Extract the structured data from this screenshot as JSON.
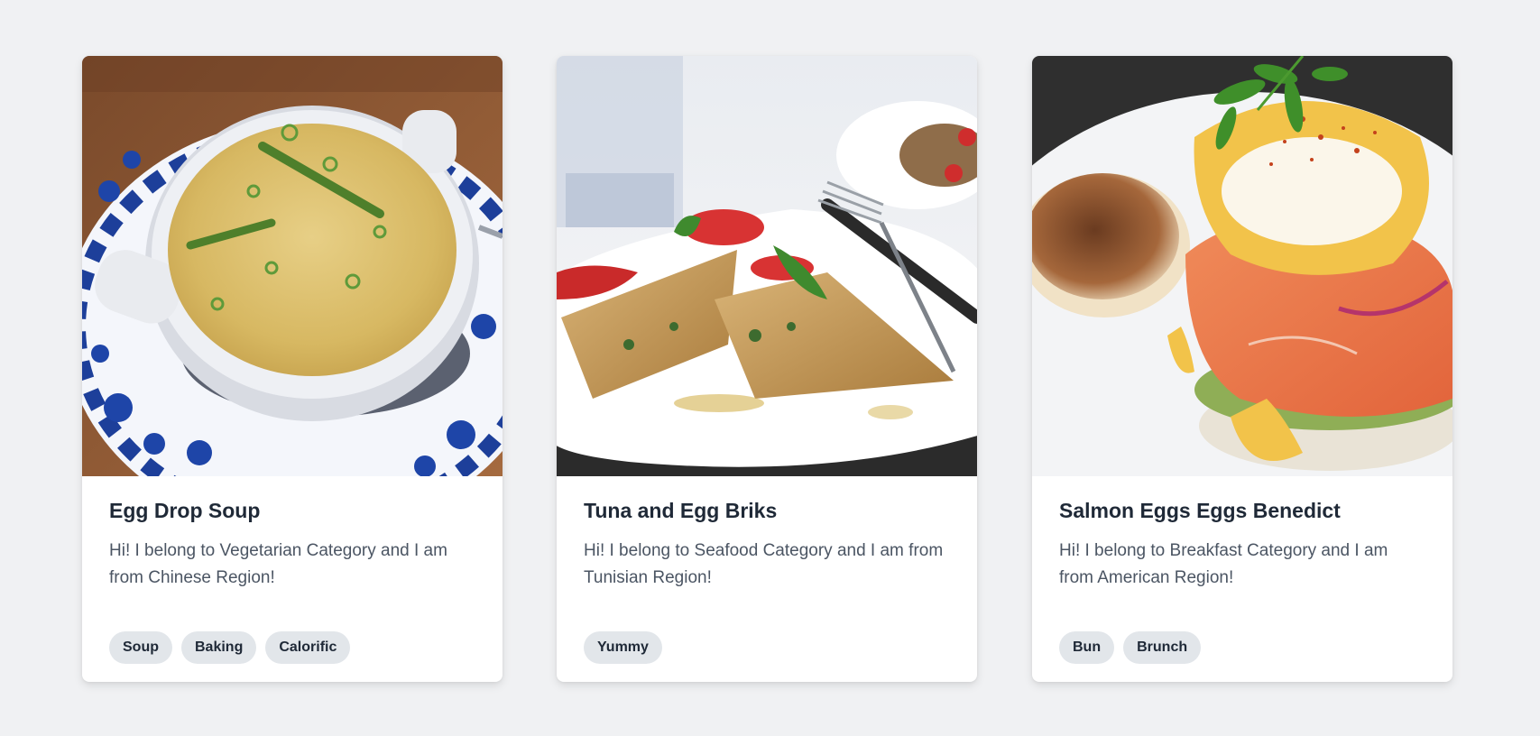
{
  "cards": [
    {
      "title": "Egg Drop Soup",
      "description": "Hi! I belong to Vegetarian Category and I am from Chinese Region!",
      "image_icon": "egg-drop-soup-photo",
      "tags": [
        "Soup",
        "Baking",
        "Calorific"
      ]
    },
    {
      "title": "Tuna and Egg Briks",
      "description": "Hi! I belong to Seafood Category and I am from Tunisian Region!",
      "image_icon": "tuna-egg-briks-photo",
      "tags": [
        "Yummy"
      ]
    },
    {
      "title": "Salmon Eggs Eggs Benedict",
      "description": "Hi! I belong to Breakfast Category and I am from American Region!",
      "image_icon": "salmon-eggs-benedict-photo",
      "tags": [
        "Bun",
        "Brunch"
      ]
    }
  ],
  "colors": {
    "page_background": "#f0f1f3",
    "card_background": "#ffffff",
    "tag_background": "#e2e6ea",
    "title_text": "#1f2937",
    "body_text": "#4b5563"
  }
}
